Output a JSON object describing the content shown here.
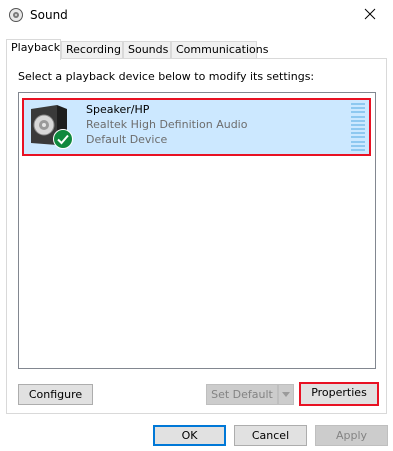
{
  "window": {
    "title": "Sound",
    "icon": "speaker-icon",
    "close_icon": "close-icon"
  },
  "tabs": [
    {
      "label": "Playback",
      "active": true
    },
    {
      "label": "Recording",
      "active": false
    },
    {
      "label": "Sounds",
      "active": false
    },
    {
      "label": "Communications",
      "active": false
    }
  ],
  "playback": {
    "instruction": "Select a playback device below to modify its settings:",
    "devices": [
      {
        "name": "Speaker/HP",
        "driver": "Realtek High Definition Audio",
        "status": "Default Device",
        "icon": "speaker-icon",
        "badge_icon": "green-check-icon",
        "selected": true
      }
    ],
    "buttons": {
      "configure": "Configure",
      "set_default": "Set Default",
      "properties": "Properties"
    }
  },
  "dialog_buttons": {
    "ok": "OK",
    "cancel": "Cancel",
    "apply": "Apply"
  },
  "colors": {
    "selection": "#cce8ff",
    "highlight_outline": "#e81123",
    "default_button_border": "#0078d7",
    "check_badge": "#10893e"
  }
}
